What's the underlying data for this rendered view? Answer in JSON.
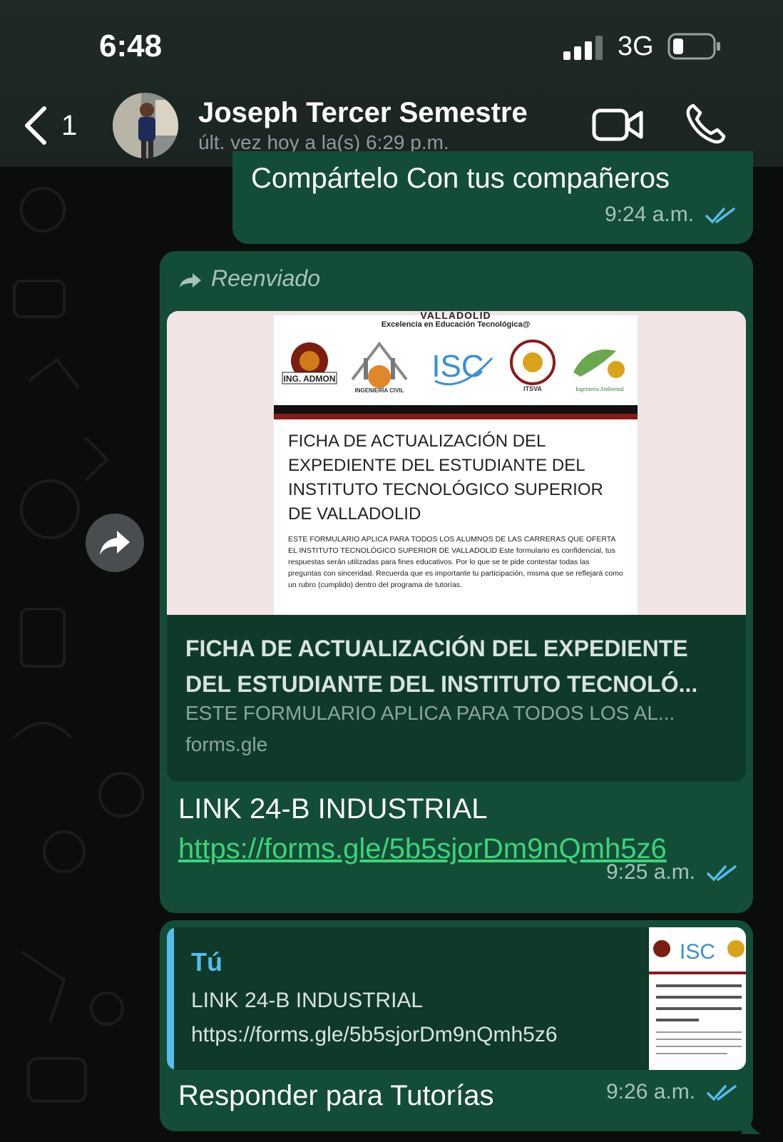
{
  "status_bar": {
    "time": "6:48",
    "network": "3G"
  },
  "header": {
    "unread_count": "1",
    "contact_name": "Joseph Tercer Semestre",
    "last_seen": "últ. vez hoy a la(s) 6:29 p.m."
  },
  "messages": [
    {
      "text": "Compártelo Con tus compañeros",
      "time": "9:24 a.m."
    },
    {
      "forwarded_label": "Reenviado",
      "preview": {
        "image_header": "Excelencia en Educación Tecnológica@",
        "image_header_top": "VALLADOLID",
        "logo_labels": [
          "ING. ADMON",
          "INGENIERÍA CIVIL",
          "ISC",
          "ITSVA",
          "Ingeniería Ambiental"
        ],
        "form_title": "FICHA DE ACTUALIZACIÓN DEL EXPEDIENTE DEL ESTUDIANTE DEL INSTITUTO TECNOLÓGICO SUPERIOR DE VALLADOLID",
        "form_desc": "ESTE FORMULARIO APLICA PARA TODOS LOS ALUMNOS DE LAS CARRERAS QUE OFERTA EL INSTITUTO TECNOLÓGICO SUPERIOR DE VALLADOLID Este formulario es confidencial, tus respuestas serán utilizadas para fines educativos. Por lo que se te pide contestar todas las preguntas con sinceridad. Recuerda que es importante tu participación, misma que se reflejará como un rubro (cumplido) dentro del programa de tutorías.",
        "title": "FICHA DE ACTUALIZACIÓN DEL EXPEDIENTE DEL ESTUDIANTE DEL INSTITUTO TECNOLÓ...",
        "description": "ESTE FORMULARIO APLICA PARA TODOS LOS AL...",
        "domain": "forms.gle"
      },
      "text": "LINK 24-B INDUSTRIAL",
      "url": "https://forms.gle/5b5sjorDm9nQmh5z6",
      "time": "9:25 a.m."
    },
    {
      "quote": {
        "author": "Tú",
        "line1": "LINK 24-B INDUSTRIAL",
        "line2": "https://forms.gle/5b5sjorDm9nQmh5z6"
      },
      "text": "Responder para Tutorías",
      "time": "9:26 a.m."
    }
  ],
  "colors": {
    "bubble": "#134d37",
    "tick_blue": "#53bdeb",
    "link_green": "#3ed37a"
  }
}
